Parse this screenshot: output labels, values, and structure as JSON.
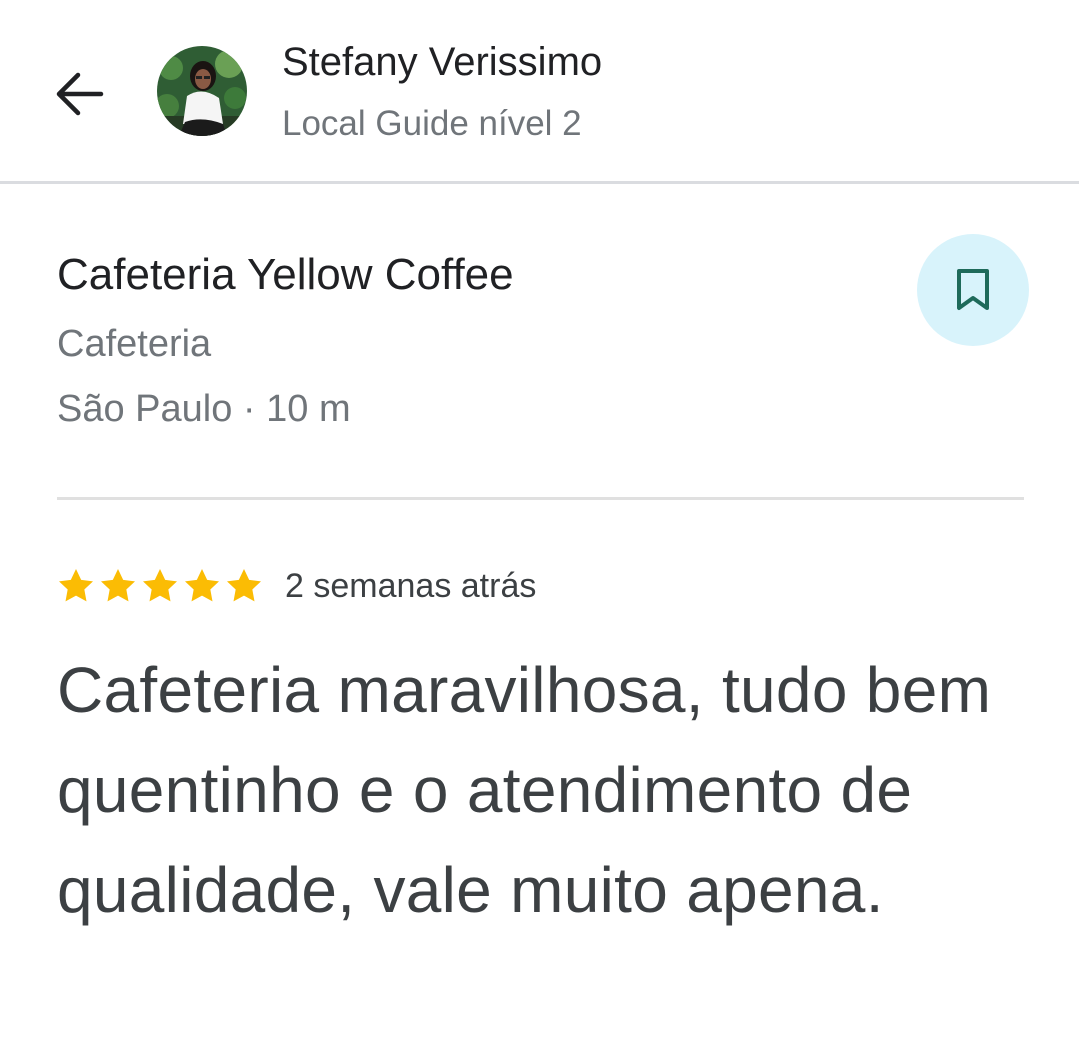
{
  "header": {
    "back_icon": "arrow-back-icon",
    "user": {
      "name": "Stefany Verissimo",
      "level": "Local Guide nível 2"
    }
  },
  "place": {
    "name": "Cafeteria Yellow Coffee",
    "category": "Cafeteria",
    "location": "São Paulo · 10 m",
    "save_icon": "bookmark-icon"
  },
  "review": {
    "rating": 5,
    "rating_max": 5,
    "date": "2 semanas atrás",
    "text": "Cafeteria maravilhosa, tudo bem quentinho e o atendimento de qualidade, vale muito apena."
  },
  "colors": {
    "star": "#fbbc04",
    "save_bg": "#d8f3fb",
    "save_icon": "#1e6a5a",
    "secondary_text": "#70757a",
    "primary_text": "#202124"
  }
}
